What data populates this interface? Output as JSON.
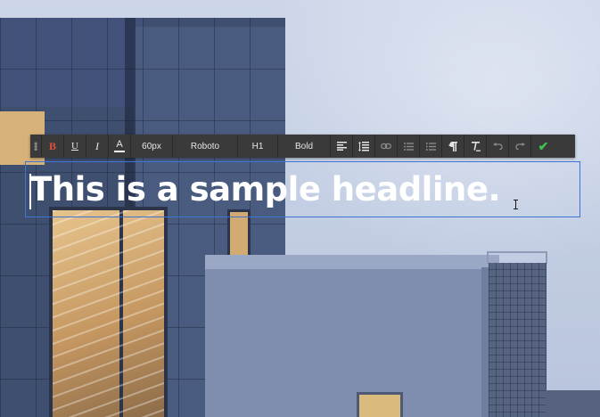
{
  "toolbar": {
    "handle_icon": "drag-handle-icon",
    "bold_label": "B",
    "underline_label": "U",
    "italic_label": "I",
    "text_color_label": "A",
    "font_size": "60px",
    "font_family": "Roboto",
    "heading_level": "H1",
    "font_weight": "Bold",
    "icons": {
      "align": "align-left-icon",
      "line_height": "line-height-icon",
      "link": "link-icon",
      "bullet_list": "bullet-list-icon",
      "numbered_list": "numbered-list-icon",
      "paragraph": "paragraph-icon",
      "clear_format": "clear-format-icon",
      "undo": "undo-icon",
      "redo": "redo-icon",
      "confirm": "checkmark-icon"
    },
    "colors": {
      "background": "#3a3a3a",
      "bold_accent": "#e24f3f",
      "confirm_accent": "#3fc24f"
    }
  },
  "editor": {
    "headline": "This is a sample headline.",
    "border_color": "#3f74d3"
  }
}
